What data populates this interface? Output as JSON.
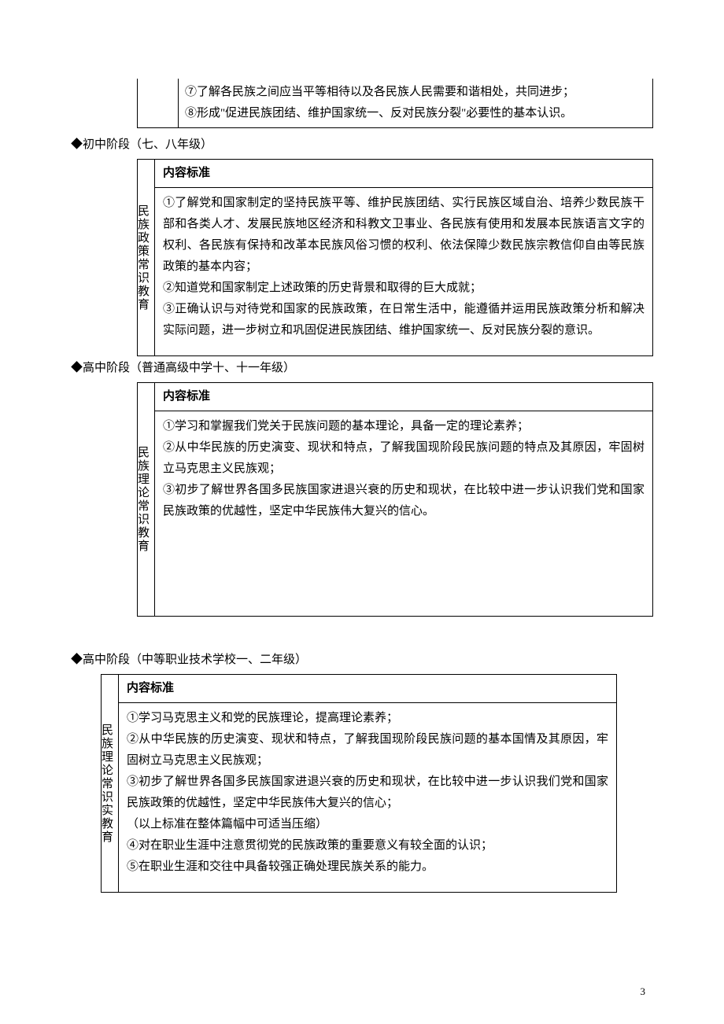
{
  "topBox": {
    "item7": "⑦了解各民族之间应当平等相待以及各民族人民需要和谐相处，共同进步；",
    "item8": "⑧形成\"促进民族团结、维护国家统一、反对民族分裂\"必要性的基本认识。"
  },
  "section1": {
    "heading": "◆初中阶段（七、八年级）",
    "label": "民族政策常识教育",
    "headerTitle": "内容标准",
    "body1": "①了解党和国家制定的坚持民族平等、维护民族团结、实行民族区域自治、培养少数民族干部和各类人才、发展民族地区经济和科教文卫事业、各民族有使用和发展本民族语言文字的权利、各民族有保持和改革本民族风俗习惯的权利、依法保障少数民族宗教信仰自由等民族政策的基本内容；",
    "body2": "②知道党和国家制定上述政策的历史背景和取得的巨大成就；",
    "body3": "③正确认识与对待党和国家的民族政策，在日常生活中，能遵循并运用民族政策分析和解决实际问题，进一步树立和巩固促进民族团结、维护国家统一、反对民族分裂的意识。"
  },
  "section2": {
    "heading": "◆高中阶段（普通高级中学十、十一年级）",
    "label": "民族理论常识教育",
    "headerTitle": "内容标准",
    "body1": "①学习和掌握我们党关于民族问题的基本理论，具备一定的理论素养；",
    "body2": "②从中华民族的历史演变、现状和特点，了解我国现阶段民族问题的特点及其原因，牢固树立马克思主义民族观；",
    "body3": "③初步了解世界各国多民族国家进退兴衰的历史和现状，在比较中进一步认识我们党和国家民族政策的优越性，坚定中华民族伟大复兴的信心。"
  },
  "section3": {
    "heading": "◆高中阶段（中等职业技术学校一、二年级）",
    "label": "民族理论常识实教育",
    "headerTitle": "内容标准",
    "body1": "①学习马克思主义和党的民族理论，提高理论素养；",
    "body2": "②从中华民族的历史演变、现状和特点，了解我国现阶段民族问题的基本国情及其原因，牢固树立马克思主义民族观；",
    "body3": "③初步了解世界各国多民族国家进退兴衰的历史和现状，在比较中进一步认识我们党和国家民族政策的优越性，坚定中华民族伟大复兴的信心；",
    "note": "（以上标准在整体篇幅中可适当压缩）",
    "body4": "④对在职业生涯中注意贯彻党的民族政策的重要意义有较全面的认识；",
    "body5": "⑤在职业生涯和交往中具备较强正确处理民族关系的能力。"
  },
  "pageNumber": "3"
}
